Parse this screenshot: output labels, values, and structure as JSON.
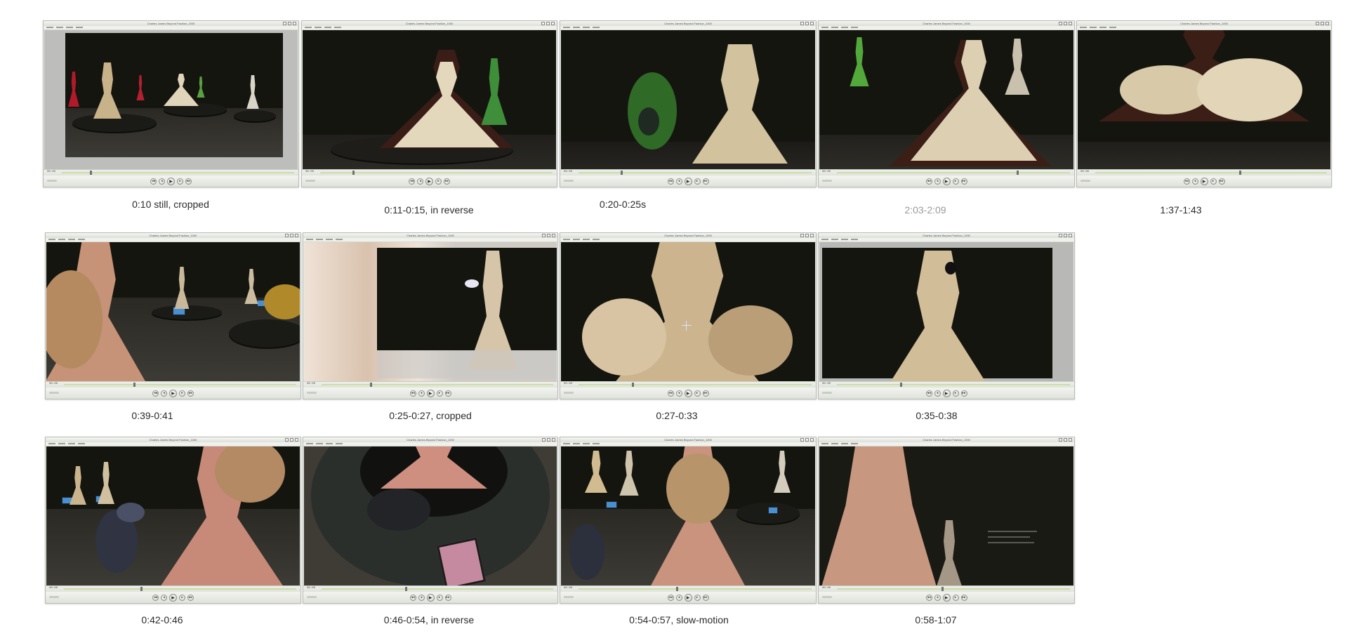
{
  "player": {
    "window_title": "Charles James Beyond Fashion_1000",
    "control_icons": [
      "rewind-icon",
      "step-back-icon",
      "play-icon",
      "step-forward-icon",
      "fast-forward-icon"
    ],
    "control_glyphs": [
      "◂◂",
      "◂",
      "▶",
      "▸",
      "▸▸"
    ]
  },
  "frames": [
    {
      "caption": "0:10 still, cropped",
      "progress": 0.12,
      "dim": false
    },
    {
      "caption": "0:11-0:15, in reverse",
      "progress": 0.14,
      "dim": false
    },
    {
      "caption": "0:20-0:25s",
      "progress": 0.18,
      "dim": false
    },
    {
      "caption": "2:03-2:09",
      "progress": 0.77,
      "dim": true
    },
    {
      "caption": "1:37-1:43",
      "progress": 0.62,
      "dim": false
    },
    {
      "caption": "0:39-0:41",
      "progress": 0.3,
      "dim": false
    },
    {
      "caption": "0:25-0:27, cropped",
      "progress": 0.21,
      "dim": false
    },
    {
      "caption": "0:27-0:33",
      "progress": 0.23,
      "dim": false
    },
    {
      "caption": "0:35-0:38",
      "progress": 0.27,
      "dim": false
    },
    {
      "caption": "0:42-0:46",
      "progress": 0.33,
      "dim": false
    },
    {
      "caption": "0:46-0:54, in reverse",
      "progress": 0.36,
      "dim": false
    },
    {
      "caption": "0:54-0:57, slow-motion",
      "progress": 0.42,
      "dim": false
    },
    {
      "caption": "0:58-1:07",
      "progress": 0.45,
      "dim": false
    }
  ]
}
